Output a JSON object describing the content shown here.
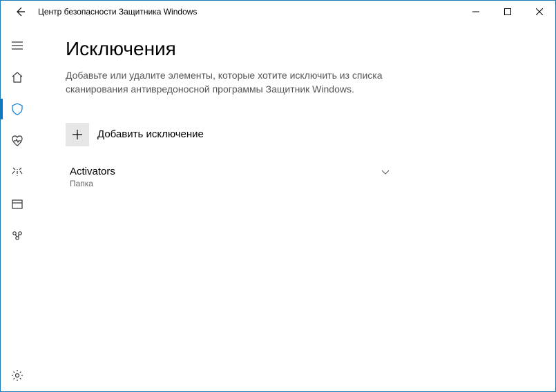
{
  "titlebar": {
    "title": "Центр безопасности Защитника Windows"
  },
  "page": {
    "heading": "Исключения",
    "description": "Добавьте или удалите элементы, которые хотите исключить из списка сканирования антивредоносной программы Защитник Windows."
  },
  "addButton": {
    "label": "Добавить исключение"
  },
  "exclusions": [
    {
      "name": "Activators",
      "type": "Папка"
    }
  ]
}
